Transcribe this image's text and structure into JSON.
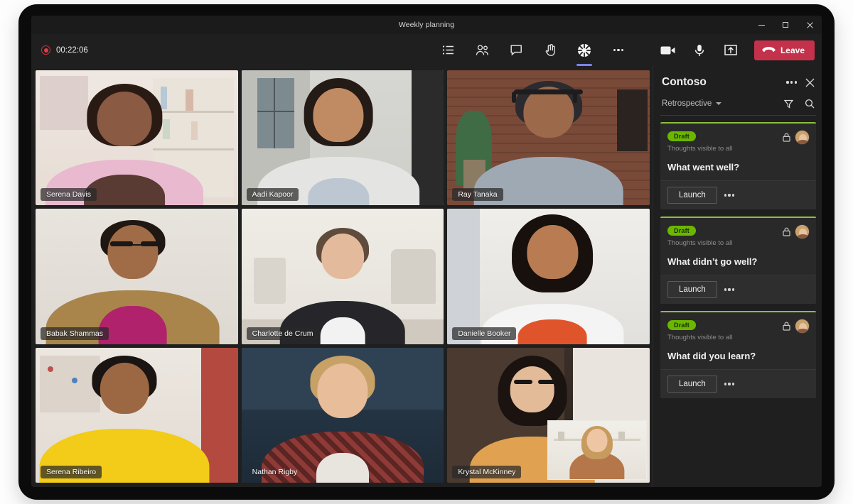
{
  "window": {
    "title": "Weekly planning",
    "controls": {
      "minimize": "minimize",
      "maximize": "maximize",
      "close": "close"
    }
  },
  "toolbar": {
    "recording_timer": "00:22:06",
    "items": [
      {
        "name": "agenda-icon",
        "label": "Agenda"
      },
      {
        "name": "people-icon",
        "label": "People"
      },
      {
        "name": "chat-icon",
        "label": "Chat"
      },
      {
        "name": "raise-hand-icon",
        "label": "Raise hand"
      },
      {
        "name": "apps-icon",
        "label": "Apps",
        "active": true
      },
      {
        "name": "more-icon",
        "label": "More actions"
      }
    ],
    "camera_label": "Camera",
    "mic_label": "Microphone",
    "share_label": "Share content",
    "leave_label": "Leave"
  },
  "grid": {
    "participants": [
      {
        "name": "Serena Davis"
      },
      {
        "name": "Aadi Kapoor"
      },
      {
        "name": "Ray Tanaka"
      },
      {
        "name": "Babak Shammas"
      },
      {
        "name": "Charlotte de Crum"
      },
      {
        "name": "Danielle Booker"
      },
      {
        "name": "Serena Ribeiro"
      },
      {
        "name": "Nathan Rigby"
      },
      {
        "name": "Krystal McKinney"
      }
    ]
  },
  "panel": {
    "title": "Contoso",
    "more_label": "More options",
    "close_label": "Close",
    "selected_view": "Retrospective",
    "filter_label": "Filter",
    "search_label": "Search",
    "cards": [
      {
        "badge": "Draft",
        "visibility": "Thoughts visible to all",
        "title": "What went well?",
        "launch_label": "Launch",
        "more_label": "More options"
      },
      {
        "badge": "Draft",
        "visibility": "Thoughts visible to all",
        "title": "What didn’t go well?",
        "launch_label": "Launch",
        "more_label": "More options"
      },
      {
        "badge": "Draft",
        "visibility": "Thoughts visible to all",
        "title": "What did you learn?",
        "launch_label": "Launch",
        "more_label": "More options"
      }
    ]
  },
  "colors": {
    "accent": "#7b83eb",
    "leave": "#c4314b",
    "badge": "#6bb700",
    "card_border": "#8cbf3f",
    "app_bg": "#1f1f1f"
  }
}
